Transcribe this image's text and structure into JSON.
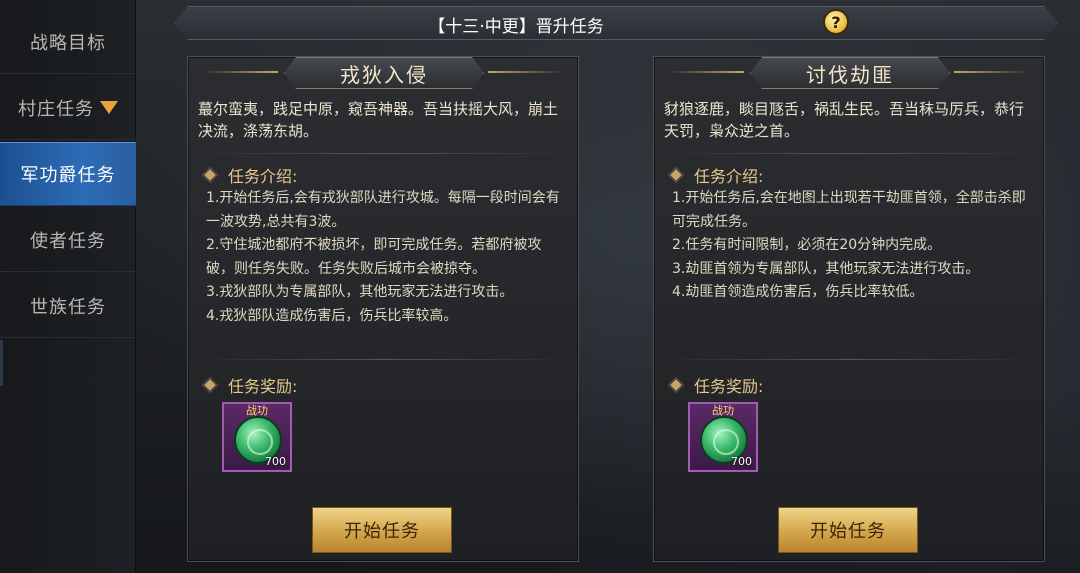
{
  "sidebar": {
    "items": [
      {
        "label": "战略目标"
      },
      {
        "label": "村庄任务"
      },
      {
        "label": "军功爵任务"
      },
      {
        "label": "使者任务"
      },
      {
        "label": "世族任务"
      }
    ],
    "active_index": 2
  },
  "header": {
    "title": "【十三·中更】晋升任务",
    "help_symbol": "?"
  },
  "panels": [
    {
      "name": "戎狄入侵",
      "intro": "蕞尔蛮夷，践足中原，窥吾神器。吾当扶摇大风，崩土决流，涤荡东胡。",
      "section_title": "任务介绍:",
      "rules": [
        "1.开始任务后,会有戎狄部队进行攻城。每隔一段时间会有一波攻势,总共有3波。",
        "2.守住城池都府不被损坏，即可完成任务。若都府被攻破，则任务失败。任务失败后城市会被掠夺。",
        "3.戎狄部队为专属部队，其他玩家无法进行攻击。",
        "4.戎狄部队造成伤害后，伤兵比率较高。"
      ],
      "reward_title": "任务奖励:",
      "reward": {
        "tag": "战功",
        "count": "700",
        "icon": "jade-medal-icon"
      },
      "button": "开始任务"
    },
    {
      "name": "讨伐劫匪",
      "intro": "豺狼逐鹿，睒目豗舌，祸乱生民。吾当秣马厉兵，恭行天罚，枭众逆之首。",
      "section_title": "任务介绍:",
      "rules": [
        "1.开始任务后,会在地图上出现若干劫匪首领，全部击杀即可完成任务。",
        "2.任务有时间限制，必须在20分钟内完成。",
        "3.劫匪首领为专属部队，其他玩家无法进行攻击。",
        "4.劫匪首领造成伤害后，伤兵比率较低。"
      ],
      "reward_title": "任务奖励:",
      "reward": {
        "tag": "战功",
        "count": "700",
        "icon": "jade-medal-icon"
      },
      "button": "开始任务"
    }
  ],
  "colors": {
    "accent_gold": "#d3a64a",
    "active_tab_blue": "#2d6cb6",
    "reward_frame_purple": "#a35bb5"
  }
}
